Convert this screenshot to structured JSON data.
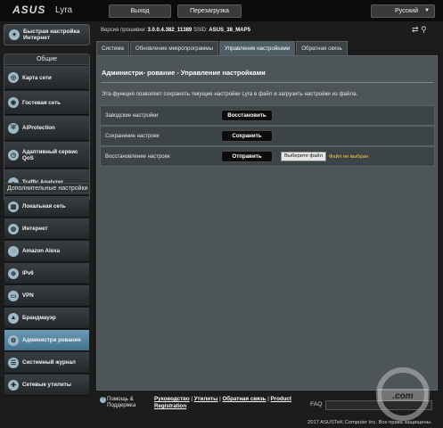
{
  "header": {
    "brand": "ASUS",
    "product": "Lyra",
    "logout_label": "Выход",
    "reboot_label": "Перезагрузка",
    "language": "Русский"
  },
  "firmware": {
    "version_label": "Версия прошивки:",
    "version_value": "3.0.0.4.382_11389",
    "ssid_label": "SSID:",
    "ssid_value": "ASUS_38_MAP5"
  },
  "sidebar": {
    "quick_setup": "Быстрая настройка Интернет",
    "general_title": "Общие",
    "general_items": [
      {
        "label": "Карта сети",
        "icon": "network-map-icon"
      },
      {
        "label": "Гостевая сеть",
        "icon": "guest-network-icon"
      },
      {
        "label": "AiProtection",
        "icon": "shield-icon"
      },
      {
        "label": "Адаптивный сервис QoS",
        "icon": "qos-icon"
      },
      {
        "label": "Traffic Analyzer",
        "icon": "traffic-analyzer-icon"
      }
    ],
    "advanced_title": "Дополнительные настройки",
    "advanced_items": [
      {
        "label": "Локальная сеть",
        "icon": "lan-icon"
      },
      {
        "label": "Интернет",
        "icon": "globe-icon"
      },
      {
        "label": "Amazon Alexa",
        "icon": "alexa-icon"
      },
      {
        "label": "IPv6",
        "icon": "ipv6-icon"
      },
      {
        "label": "VPN",
        "icon": "vpn-icon"
      },
      {
        "label": "Брандмауэр",
        "icon": "firewall-icon"
      },
      {
        "label": "Администри рование",
        "icon": "admin-icon",
        "active": true
      },
      {
        "label": "Системный журнал",
        "icon": "log-icon"
      },
      {
        "label": "Сетевые утилиты",
        "icon": "tools-icon"
      }
    ]
  },
  "tabs": [
    "Система",
    "Обновление микропрограммы",
    "Управление настройками",
    "Обратная связь"
  ],
  "active_tab": 2,
  "panel": {
    "title": "Администри- рование - Управление настройками",
    "description": "Эта функция позволяет сохранять текущие настройки Lyra в файл и загрузить настройки из файла.",
    "rows": [
      {
        "label": "Заводские настройки",
        "button": "Восстановить"
      },
      {
        "label": "Сохранение настроек",
        "button": "Сохранить"
      },
      {
        "label": "Восстановление настроек",
        "button": "Отправить",
        "file_button": "Выберите файл",
        "file_status": "Файл не выбран"
      }
    ]
  },
  "footer": {
    "help": "Помощь & Поддержка",
    "links": [
      "Руководство",
      "Утилиты",
      "Обратная связь",
      "Product Registration"
    ],
    "faq": "FAQ",
    "copyright": "2017 ASUSTeK Computer Inc. Все права защищены."
  },
  "colors": {
    "accent_active": "#5b8aa6",
    "warning_text": "#ffcc33",
    "panel_bg": "#4d5559"
  }
}
